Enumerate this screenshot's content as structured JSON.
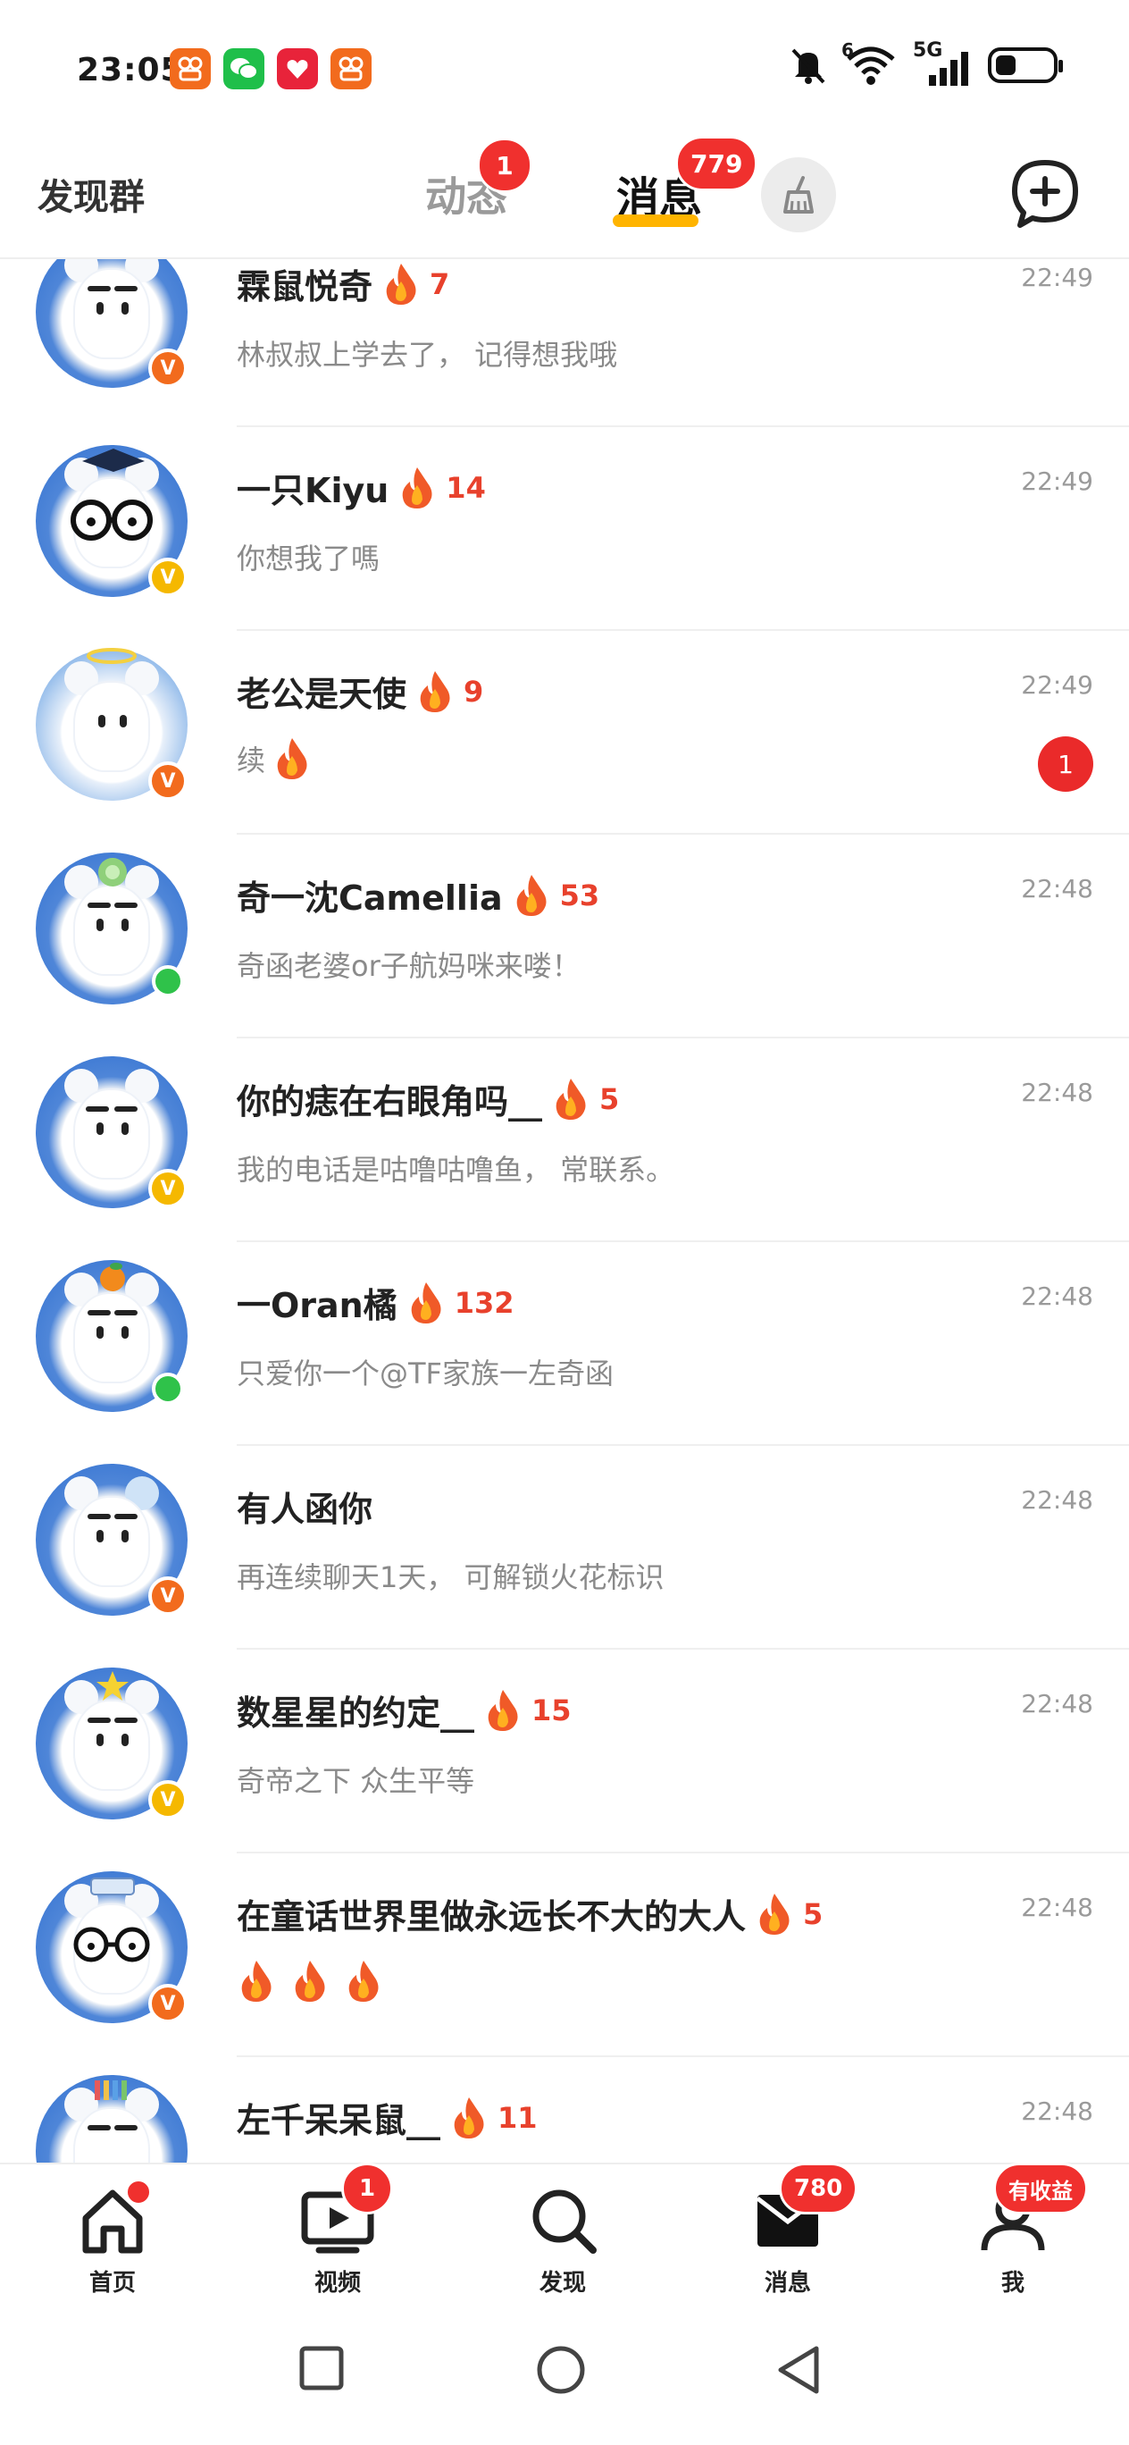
{
  "status_bar": {
    "time": "23:05",
    "network": "5G",
    "sim_slot": "6"
  },
  "header": {
    "left_label": "发现群",
    "tabs": [
      {
        "label": "动态",
        "badge": "1"
      },
      {
        "label": "消息",
        "badge": "779",
        "active": true
      }
    ]
  },
  "conversations": [
    {
      "name": "霖鼠悦奇",
      "streak": "7",
      "preview": "林叔叔上学去了， 记得想我哦",
      "time": "22:49",
      "badge": "v-orange",
      "unread": ""
    },
    {
      "name": "一只Kiyu",
      "streak": "14",
      "preview": "你想我了嗎",
      "time": "22:49",
      "badge": "v-gold",
      "unread": ""
    },
    {
      "name": "老公是天使",
      "streak": "9",
      "preview": "续",
      "time": "22:49",
      "badge": "v-orange",
      "unread": "1"
    },
    {
      "name": "奇一沈Camellia",
      "streak": "53",
      "preview": "奇函老婆or子航妈咪来喽！",
      "time": "22:48",
      "badge": "online",
      "unread": ""
    },
    {
      "name": "你的痣在右眼角吗__",
      "streak": "5",
      "preview": "我的电话是咕噜咕噜鱼， 常联系。",
      "time": "22:48",
      "badge": "v-gold",
      "unread": ""
    },
    {
      "name": "一Oran橘",
      "streak": "132",
      "preview": "只爱你一个@TF家族一左奇函",
      "time": "22:48",
      "badge": "online",
      "unread": ""
    },
    {
      "name": "有人函你",
      "streak": "",
      "preview": "再连续聊天1天， 可解锁火花标识",
      "time": "22:48",
      "badge": "v-orange",
      "unread": ""
    },
    {
      "name": "数星星的约定__",
      "streak": "15",
      "preview": "奇帝之下  众生平等",
      "time": "22:48",
      "badge": "v-gold",
      "unread": ""
    },
    {
      "name": "在童话世界里做永远长不大的大人",
      "streak": "5",
      "preview": "",
      "time": "22:48",
      "badge": "v-orange",
      "unread": ""
    },
    {
      "name": "左千呆呆鼠__",
      "streak": "11",
      "preview": "",
      "time": "22:48",
      "badge": "",
      "unread": ""
    }
  ],
  "bottom_nav": [
    {
      "label": "首页",
      "icon": "home-icon",
      "badge": "dot"
    },
    {
      "label": "视频",
      "icon": "video-icon",
      "badge": "1"
    },
    {
      "label": "发现",
      "icon": "search-icon",
      "badge": ""
    },
    {
      "label": "消息",
      "icon": "message-icon",
      "badge": "780"
    },
    {
      "label": "我",
      "icon": "profile-icon",
      "badge": "有收益"
    }
  ],
  "colors": {
    "accent_red": "#f0302e",
    "tab_underline": "#ffb400",
    "streak_red": "#e8412c",
    "online_green": "#2fc24a"
  }
}
